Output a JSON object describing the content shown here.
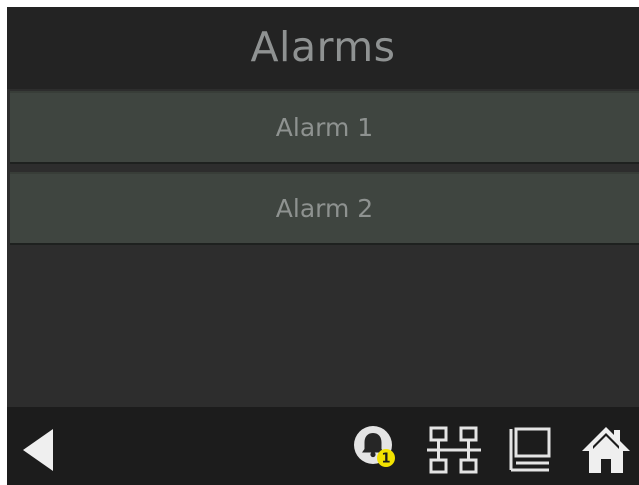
{
  "header": {
    "title": "Alarms"
  },
  "alarms": {
    "items": [
      {
        "label": "Alarm 1"
      },
      {
        "label": "Alarm 2"
      }
    ]
  },
  "footer": {
    "alarm_badge_count": "1",
    "icons": [
      "back-arrow-icon",
      "bell-icon",
      "network-icon",
      "display-icon",
      "home-icon"
    ]
  },
  "colors": {
    "screen_bg": "#2d2d2d",
    "header_bg": "#232323",
    "footer_bg": "#1c1c1c",
    "item_bg": "#3f4540",
    "text": "#8f9292",
    "icon": "#e6e6e6",
    "badge": "#f2e200"
  }
}
